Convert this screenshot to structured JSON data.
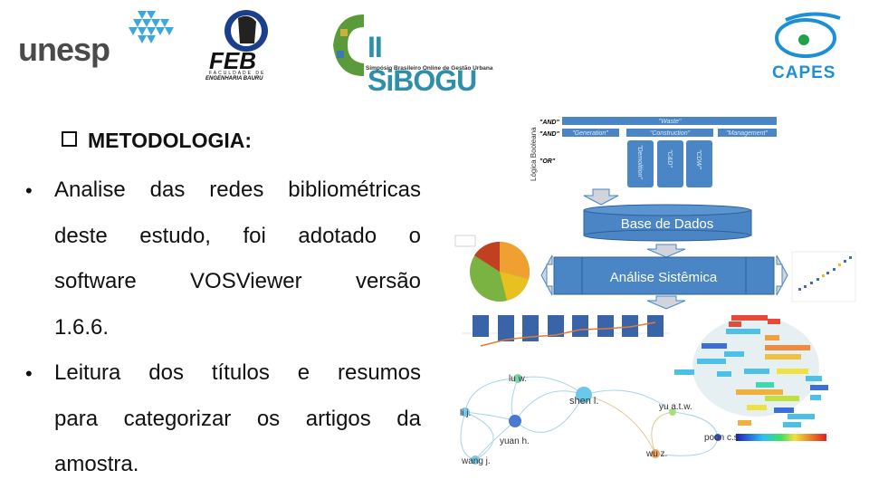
{
  "logos": {
    "unesp": "unesp",
    "feb": "FEB",
    "feb_sub1": "FACULDADE DE",
    "feb_sub2": "ENGENHARIA BAURU",
    "sibogu": "II SiBOGU",
    "sibogu_sub": "Simpósio Brasileiro Online de Gestão Urbana",
    "capes": "CAPES"
  },
  "slide": {
    "title": "METODOLOGIA:",
    "bullets": [
      {
        "lines": [
          "Analise das redes bibliométricas",
          "deste estudo, foi adotado o",
          "software VOSViewer versão",
          "1.6.6."
        ]
      },
      {
        "lines": [
          "Leitura dos títulos e resumos",
          "para categorizar os artigos da",
          "amostra."
        ]
      }
    ]
  },
  "diagram": {
    "side_label": "Lógica Booleana",
    "and1": "\"AND\"",
    "and2": "\"AND\"",
    "or": "\"OR\"",
    "waste": "\"Waste\"",
    "generation": "\"Generation\"",
    "construction": "\"Construction\"",
    "management": "\"Management\"",
    "demolition": "\"Demolition\"",
    "cd": "\"C&D\"",
    "cdw": "\"CDW\"",
    "database": "Base de Dados",
    "analysis": "Análise Sistêmica",
    "accent": "#4a86c5"
  },
  "network": {
    "nodes": [
      "lu w.",
      "li j.",
      "yuan h.",
      "wang j.",
      "shen l.",
      "yu a.t.w.",
      "wu z.",
      "poon c.s."
    ]
  }
}
